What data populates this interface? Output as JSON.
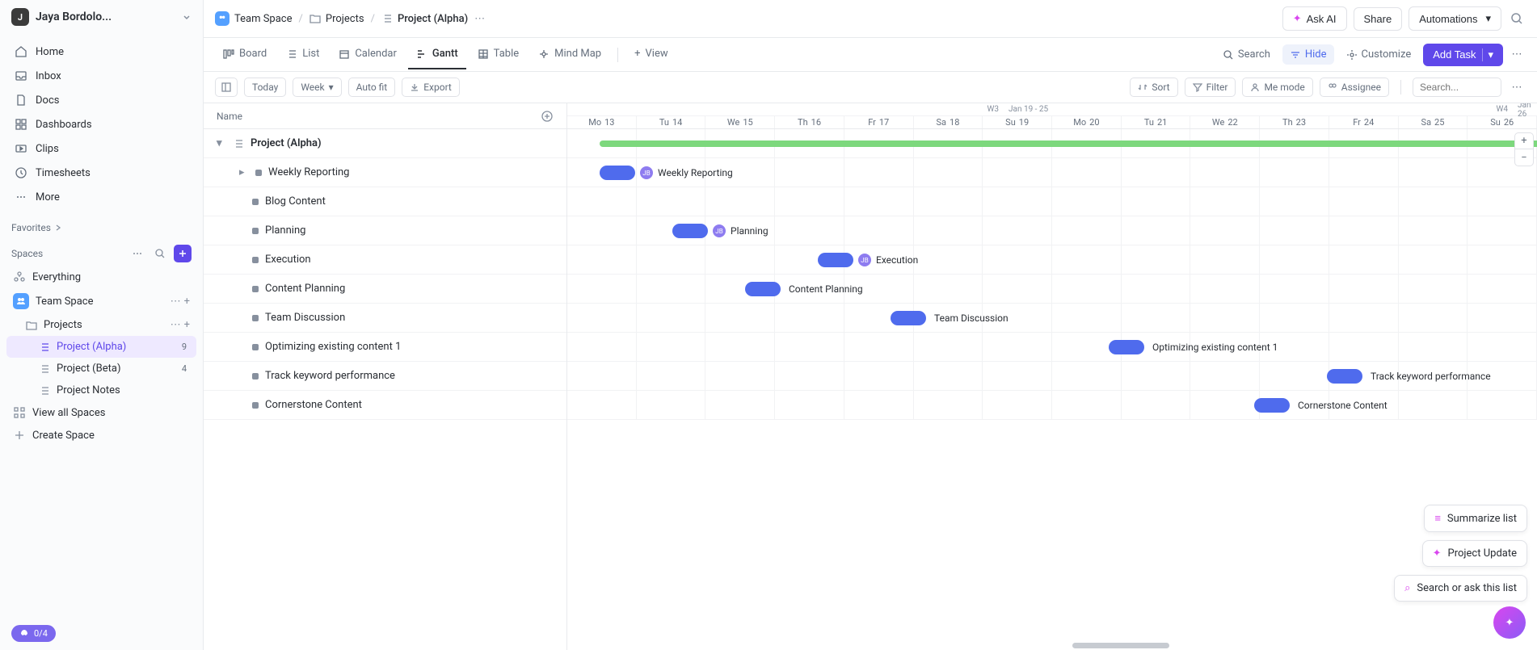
{
  "user": {
    "initial": "J",
    "name": "Jaya Bordolo..."
  },
  "sidebar": {
    "nav": [
      {
        "label": "Home"
      },
      {
        "label": "Inbox"
      },
      {
        "label": "Docs"
      },
      {
        "label": "Dashboards"
      },
      {
        "label": "Clips"
      },
      {
        "label": "Timesheets"
      },
      {
        "label": "More"
      }
    ],
    "favorites_label": "Favorites",
    "spaces_label": "Spaces",
    "everything": "Everything",
    "team_space": "Team Space",
    "projects": "Projects",
    "project_alpha": {
      "name": "Project (Alpha)",
      "count": "9"
    },
    "project_beta": {
      "name": "Project (Beta)",
      "count": "4"
    },
    "project_notes": "Project Notes",
    "view_all": "View all Spaces",
    "create_space": "Create Space",
    "progress": "0/4"
  },
  "breadcrumb": {
    "space": "Team Space",
    "folder": "Projects",
    "list": "Project (Alpha)"
  },
  "topbar": {
    "ask_ai": "Ask AI",
    "share": "Share",
    "automations": "Automations"
  },
  "views": {
    "board": "Board",
    "list": "List",
    "calendar": "Calendar",
    "gantt": "Gantt",
    "table": "Table",
    "mindmap": "Mind Map",
    "view": "View",
    "search": "Search",
    "hide": "Hide",
    "customize": "Customize",
    "add_task": "Add Task"
  },
  "toolbar": {
    "today": "Today",
    "week": "Week",
    "autofit": "Auto fit",
    "export": "Export",
    "sort": "Sort",
    "filter": "Filter",
    "me_mode": "Me mode",
    "assignee": "Assignee",
    "search_ph": "Search..."
  },
  "taskcol": {
    "header": "Name",
    "group": "Project (Alpha)",
    "tasks": [
      "Weekly Reporting",
      "Blog Content",
      "Planning",
      "Execution",
      "Content Planning",
      "Team Discussion",
      "Optimizing existing content 1",
      "Track keyword performance",
      "Cornerstone Content"
    ]
  },
  "timeline": {
    "week3": "W3",
    "range3": "Jan 19 - 25",
    "week4": "W4",
    "range4": "Jan 26",
    "days": [
      {
        "d": "Mo",
        "n": "13"
      },
      {
        "d": "Tu",
        "n": "14"
      },
      {
        "d": "We",
        "n": "15"
      },
      {
        "d": "Th",
        "n": "16"
      },
      {
        "d": "Fr",
        "n": "17"
      },
      {
        "d": "Sa",
        "n": "18"
      },
      {
        "d": "Su",
        "n": "19"
      },
      {
        "d": "Mo",
        "n": "20"
      },
      {
        "d": "Tu",
        "n": "21"
      },
      {
        "d": "We",
        "n": "22"
      },
      {
        "d": "Th",
        "n": "23"
      },
      {
        "d": "Fr",
        "n": "24"
      },
      {
        "d": "Sa",
        "n": "25"
      },
      {
        "d": "Su",
        "n": "26"
      }
    ]
  },
  "bars": {
    "weekly": "Weekly Reporting",
    "planning": "Planning",
    "execution": "Execution",
    "content_planning": "Content Planning",
    "team_discussion": "Team Discussion",
    "optimizing": "Optimizing existing content 1",
    "track": "Track keyword performance",
    "cornerstone": "Cornerstone Content",
    "avatar": "JB"
  },
  "float": {
    "summarize": "Summarize list",
    "update": "Project Update",
    "ask": "Search or ask this list"
  }
}
